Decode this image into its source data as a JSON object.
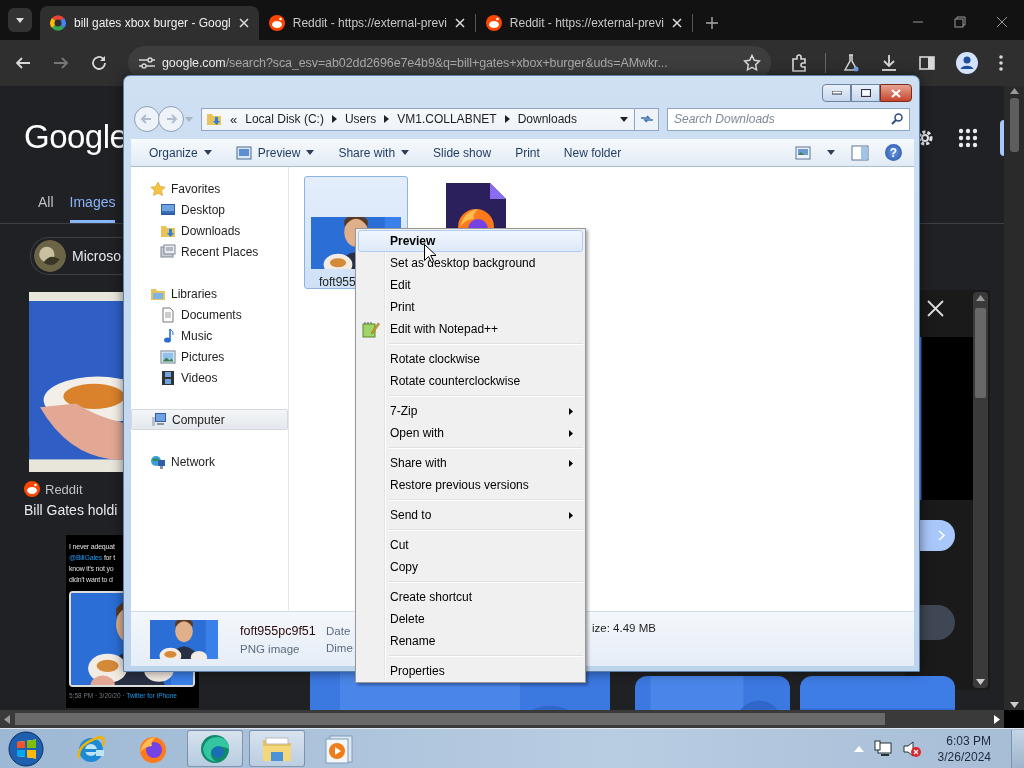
{
  "browser": {
    "tabs": [
      {
        "title": "bill gates xbox burger - Googl",
        "kind": "google",
        "selected": true
      },
      {
        "title": "Reddit - https://external-previ",
        "kind": "reddit",
        "selected": false
      },
      {
        "title": "Reddit - https://external-previ",
        "kind": "reddit",
        "selected": false
      }
    ],
    "address": {
      "host": "google.com",
      "path": "/search?sca_esv=ab02dd2696e7e4b9&q=bill+gates+xbox+burger&uds=AMwkr..."
    },
    "page": {
      "logo": "Google",
      "nav": [
        {
          "label": "All",
          "selected": false
        },
        {
          "label": "Images",
          "selected": true
        }
      ],
      "chip": "Microso",
      "result": {
        "source": "Reddit",
        "title": "Bill Gates holdi"
      },
      "tweet": {
        "lines": [
          {
            "text": "I never adequat"
          },
          {
            "mention": "@BillGates",
            "text": "for t"
          },
          {
            "text": "know it's not yo"
          },
          {
            "text": "didn't want to d"
          }
        ],
        "time": "5:58 PM · 3/20/20 ·",
        "client": "Twitter for iPhone"
      }
    }
  },
  "explorer": {
    "breadcrumb": {
      "overflow": "«",
      "items": [
        "Local Disk (C:)",
        "Users",
        "VM1.COLLABNET",
        "Downloads"
      ]
    },
    "search": {
      "placeholder": "Search Downloads"
    },
    "toolbar": [
      {
        "label": "Organize",
        "kind": "text",
        "dropdown": true
      },
      {
        "label": "Preview",
        "kind": "icon",
        "dropdown": true
      },
      {
        "label": "Share with",
        "kind": "text",
        "dropdown": true
      },
      {
        "label": "Slide show",
        "kind": "text",
        "dropdown": false
      },
      {
        "label": "Print",
        "kind": "text",
        "dropdown": false
      },
      {
        "label": "New folder",
        "kind": "text",
        "dropdown": false
      }
    ],
    "help": "?",
    "nav": [
      {
        "label": "Favorites",
        "kind": "favorites",
        "selected": false,
        "children": [
          {
            "label": "Desktop",
            "kind": "desktop",
            "selected": false
          },
          {
            "label": "Downloads",
            "kind": "downloads",
            "selected": false
          },
          {
            "label": "Recent Places",
            "kind": "recent",
            "selected": false
          }
        ]
      },
      {
        "label": "Libraries",
        "kind": "libraries",
        "selected": false,
        "children": [
          {
            "label": "Documents",
            "kind": "documents",
            "selected": false
          },
          {
            "label": "Music",
            "kind": "music",
            "selected": false
          },
          {
            "label": "Pictures",
            "kind": "pictures",
            "selected": false
          },
          {
            "label": "Videos",
            "kind": "videos",
            "selected": false
          }
        ]
      },
      {
        "label": "Computer",
        "kind": "computer",
        "selected": true
      },
      {
        "label": "Network",
        "kind": "network",
        "selected": false
      }
    ],
    "files": [
      {
        "name": "foft955",
        "selected": true
      },
      {
        "kind": "document",
        "selected": false
      }
    ],
    "details": {
      "name": "foft955pc9f51",
      "type": "PNG image",
      "field_1": "Date",
      "field_2": "Dime",
      "field_3": "ize: 4.49 MB"
    }
  },
  "context_menu": {
    "groups": [
      {
        "items": [
          {
            "label": "Preview",
            "kind": "plain",
            "default": true,
            "selected": true,
            "submenu": false
          },
          {
            "label": "Set as desktop background",
            "kind": "plain",
            "default": false,
            "selected": false,
            "submenu": false
          },
          {
            "label": "Edit",
            "kind": "plain",
            "default": false,
            "selected": false,
            "submenu": false
          },
          {
            "label": "Print",
            "kind": "plain",
            "default": false,
            "selected": false,
            "submenu": false
          },
          {
            "label": "Edit with Notepad++",
            "kind": "app",
            "default": false,
            "selected": false,
            "submenu": false
          }
        ]
      },
      {
        "items": [
          {
            "label": "Rotate clockwise",
            "kind": "plain",
            "default": false,
            "selected": false,
            "submenu": false
          },
          {
            "label": "Rotate counterclockwise",
            "kind": "plain",
            "default": false,
            "selected": false,
            "submenu": false
          }
        ]
      },
      {
        "items": [
          {
            "label": "7-Zip",
            "kind": "plain",
            "default": false,
            "selected": false,
            "submenu": true
          },
          {
            "label": "Open with",
            "kind": "plain",
            "default": false,
            "selected": false,
            "submenu": true
          }
        ]
      },
      {
        "items": [
          {
            "label": "Share with",
            "kind": "plain",
            "default": false,
            "selected": false,
            "submenu": true
          },
          {
            "label": "Restore previous versions",
            "kind": "plain",
            "default": false,
            "selected": false,
            "submenu": false
          }
        ]
      },
      {
        "items": [
          {
            "label": "Send to",
            "kind": "plain",
            "default": false,
            "selected": false,
            "submenu": true
          }
        ]
      },
      {
        "items": [
          {
            "label": "Cut",
            "kind": "plain",
            "default": false,
            "selected": false,
            "submenu": false
          },
          {
            "label": "Copy",
            "kind": "plain",
            "default": false,
            "selected": false,
            "submenu": false
          }
        ]
      },
      {
        "items": [
          {
            "label": "Create shortcut",
            "kind": "plain",
            "default": false,
            "selected": false,
            "submenu": false
          },
          {
            "label": "Delete",
            "kind": "plain",
            "default": false,
            "selected": false,
            "submenu": false
          },
          {
            "label": "Rename",
            "kind": "plain",
            "default": false,
            "selected": false,
            "submenu": false
          }
        ]
      },
      {
        "items": [
          {
            "label": "Properties",
            "kind": "plain",
            "default": false,
            "selected": false,
            "submenu": false
          }
        ]
      }
    ]
  },
  "taskbar": {
    "apps": [
      {
        "kind": "ie",
        "active": false
      },
      {
        "kind": "firefox",
        "active": false
      },
      {
        "kind": "edge",
        "active": true
      },
      {
        "kind": "explorer",
        "active": true
      },
      {
        "kind": "media",
        "active": false
      }
    ],
    "time": "6:03 PM",
    "date": "3/26/2024"
  }
}
